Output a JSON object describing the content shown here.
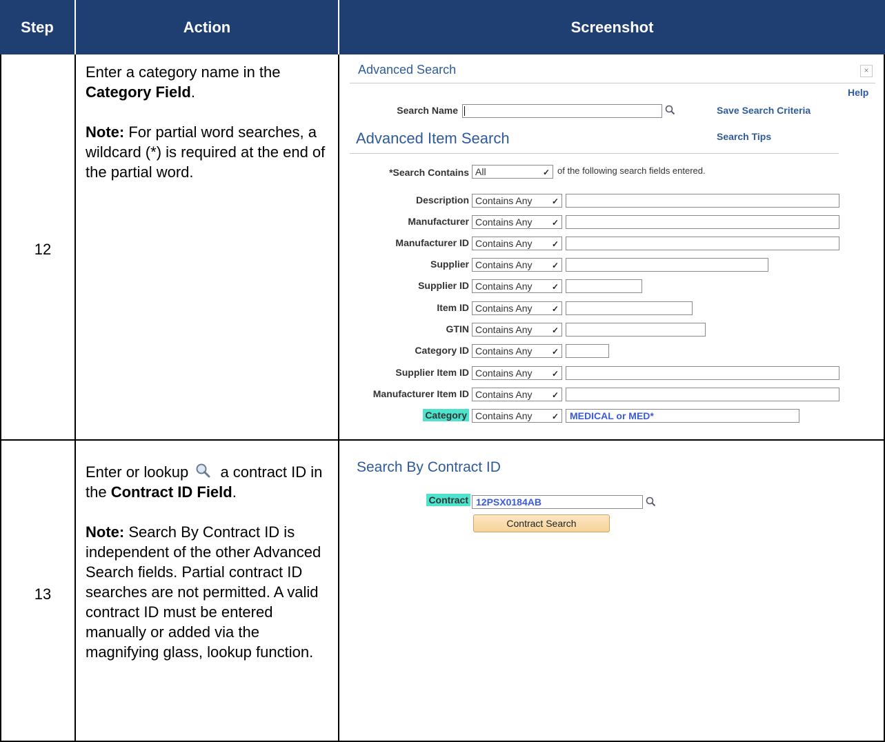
{
  "table": {
    "headers": {
      "step": "Step",
      "action": "Action",
      "screenshot": "Screenshot"
    }
  },
  "row12": {
    "step": "12",
    "action_pre": "Enter a category name in the ",
    "action_bold": "Category Field",
    "action_post": ".",
    "note_label": "Note:",
    "note_text": " For partial word searches, a wildcard (*) is required at the end of the partial word."
  },
  "row13": {
    "step": "13",
    "action_pre": "Enter or lookup",
    "action_mid": " a contract ID in the ",
    "action_bold": "Contract ID Field",
    "action_post": ".",
    "note_label": "Note:",
    "note_text": " Search By Contract ID is independent of the other Advanced Search fields. Partial contract ID searches are not permitted. A valid contract ID must be entered manually or added via the magnifying glass, lookup function."
  },
  "advanced_search": {
    "title": "Advanced Search",
    "close": "×",
    "help": "Help",
    "search_name_label": "Search Name",
    "save_link": "Save Search Criteria",
    "tips_link": "Search Tips",
    "section_title": "Advanced Item Search",
    "contains_label": "*Search Contains",
    "contains_value": "All",
    "contains_note": "of the following search fields entered.",
    "fields": [
      {
        "label": "Description",
        "operator": "Contains Any",
        "value": ""
      },
      {
        "label": "Manufacturer",
        "operator": "Contains Any",
        "value": ""
      },
      {
        "label": "Manufacturer ID",
        "operator": "Contains Any",
        "value": ""
      },
      {
        "label": "Supplier",
        "operator": "Contains Any",
        "value": ""
      },
      {
        "label": "Supplier ID",
        "operator": "Contains Any",
        "value": ""
      },
      {
        "label": "Item ID",
        "operator": "Contains Any",
        "value": ""
      },
      {
        "label": "GTIN",
        "operator": "Contains Any",
        "value": ""
      },
      {
        "label": "Category ID",
        "operator": "Contains Any",
        "value": ""
      },
      {
        "label": "Supplier Item ID",
        "operator": "Contains Any",
        "value": ""
      },
      {
        "label": "Manufacturer Item ID",
        "operator": "Contains Any",
        "value": ""
      },
      {
        "label": "Category",
        "operator": "Contains Any",
        "value": "MEDICAL or MED*"
      }
    ]
  },
  "contract_search": {
    "section_title": "Search By Contract ID",
    "contract_label": "Contract",
    "contract_value": "12PSX0184AB",
    "button_label": "Contract Search"
  }
}
